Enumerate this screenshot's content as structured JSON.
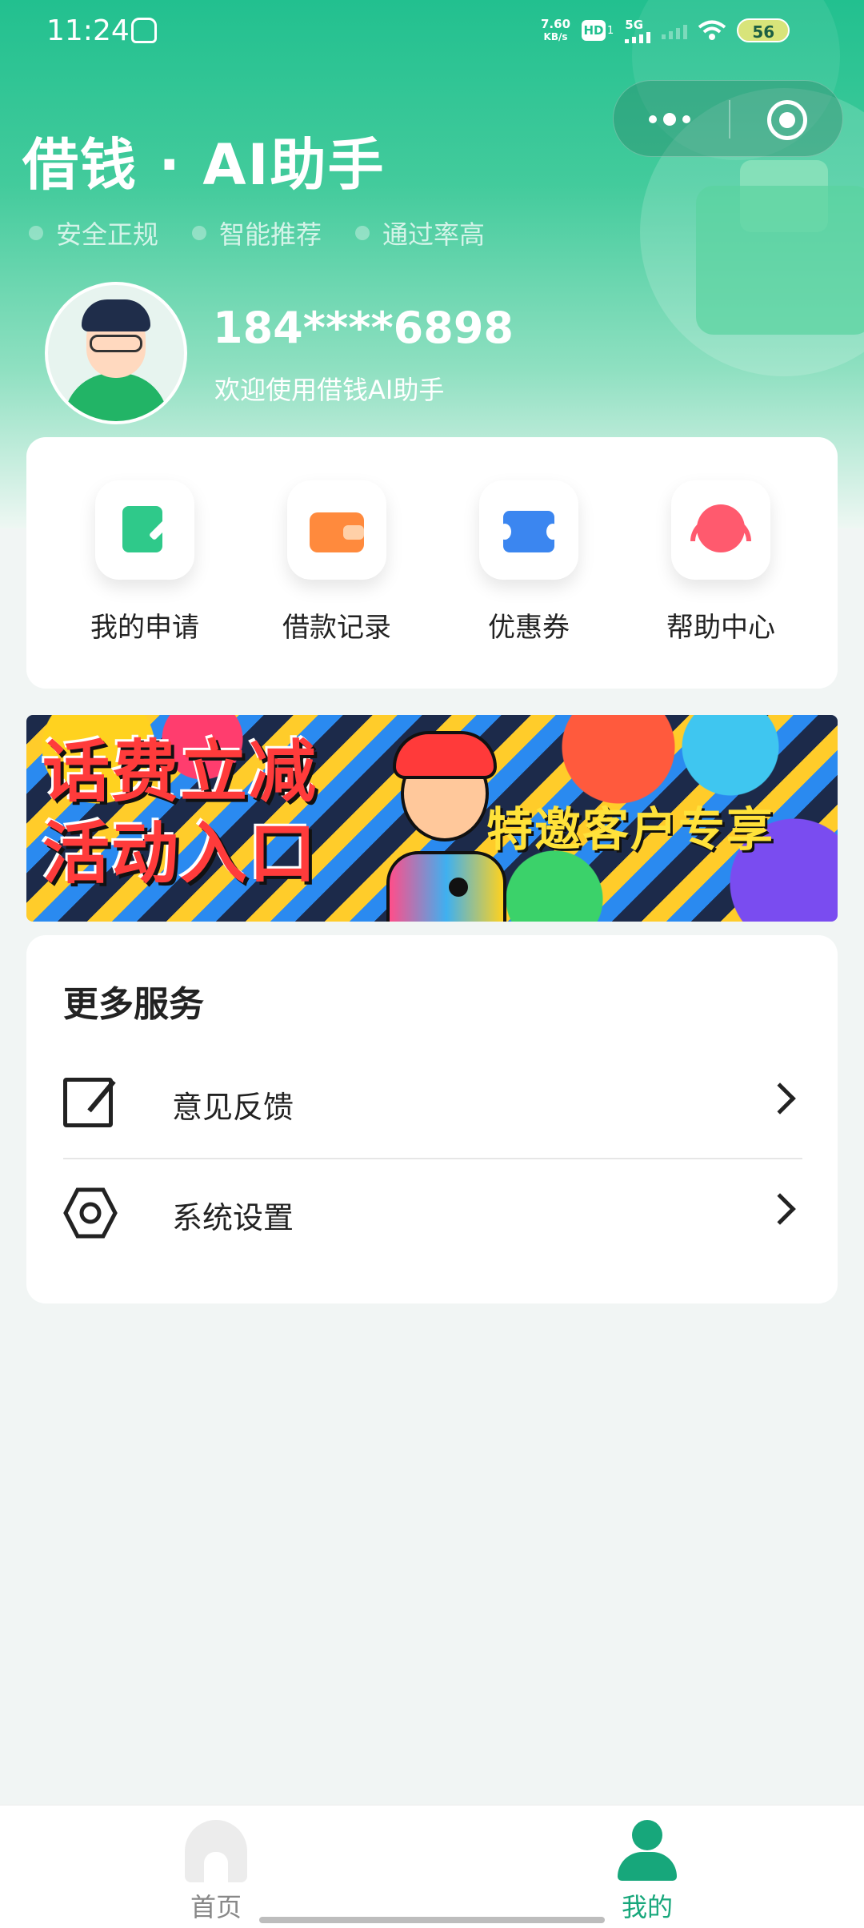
{
  "status_bar": {
    "time": "11:24",
    "net_speed_value": "7.60",
    "net_speed_unit": "KB/s",
    "hd_badge": "HD",
    "hd_sim": "1",
    "network_type": "5G",
    "battery": "56"
  },
  "header": {
    "title": "借钱 · AI助手",
    "tags": [
      "安全正规",
      "智能推荐",
      "通过率高"
    ]
  },
  "profile": {
    "phone": "184****6898",
    "welcome": "欢迎使用借钱AI助手"
  },
  "quick_actions": [
    {
      "label": "我的申请",
      "icon": "document-edit-icon"
    },
    {
      "label": "借款记录",
      "icon": "wallet-icon"
    },
    {
      "label": "优惠券",
      "icon": "coupon-icon"
    },
    {
      "label": "帮助中心",
      "icon": "headset-icon"
    }
  ],
  "banner": {
    "left_text_line1": "话费立减",
    "left_text_line2": "活动入口",
    "right_text": "特邀客户专享"
  },
  "services": {
    "title": "更多服务",
    "items": [
      {
        "label": "意见反馈",
        "icon": "feedback-edit-icon"
      },
      {
        "label": "系统设置",
        "icon": "hex-settings-icon"
      }
    ]
  },
  "tabbar": {
    "items": [
      {
        "label": "首页",
        "icon": "home-icon",
        "active": false
      },
      {
        "label": "我的",
        "icon": "person-icon",
        "active": true
      }
    ],
    "active_color": "#17a77b"
  },
  "colors": {
    "brand_green": "#22c08f",
    "page_bg": "#f1f5f4"
  }
}
